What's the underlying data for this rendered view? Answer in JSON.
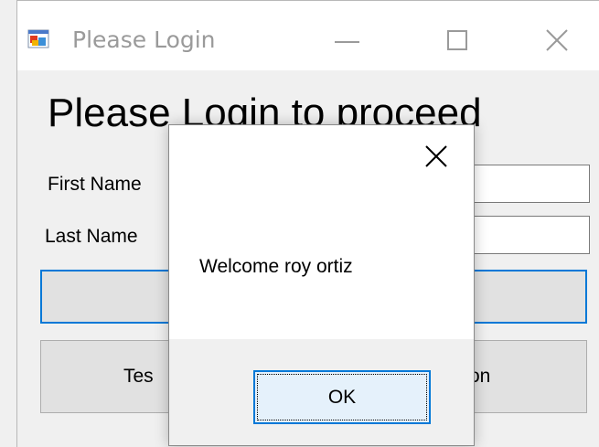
{
  "window": {
    "title": "Please Login",
    "icon": "app-window-icon",
    "controls": [
      "minimize-icon",
      "maximize-icon",
      "close-icon"
    ]
  },
  "form": {
    "heading": "Please Login to proceed",
    "first_name_label": "First Name",
    "last_name_label": "Last Name",
    "first_name_value": "",
    "last_name_value": "",
    "login_button_label": "",
    "test_button_label_visible_left": "Tes",
    "test_button_label_visible_right": "on"
  },
  "dialog": {
    "message": "Welcome roy ortiz",
    "ok_label": "OK",
    "close_icon": "close-icon"
  },
  "colors": {
    "accent": "#0078d7",
    "window_bg": "#f0f0f0",
    "button_bg": "#e1e1e1"
  }
}
